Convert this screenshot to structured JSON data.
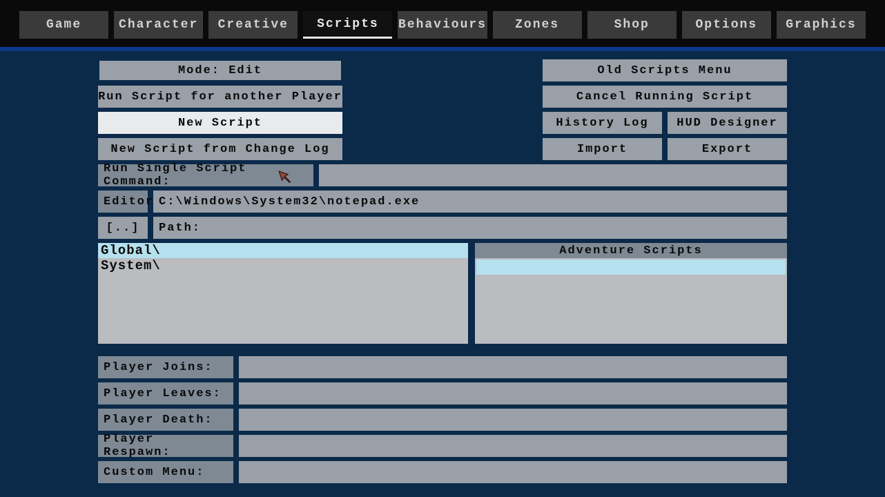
{
  "tabs": {
    "game": "Game",
    "character": "Character",
    "creative": "Creative",
    "scripts": "Scripts",
    "behaviours": "Behaviours",
    "zones": "Zones",
    "shop": "Shop",
    "options": "Options",
    "graphics": "Graphics"
  },
  "buttons": {
    "mode": "Mode: Edit",
    "run_for_player": "Run Script for another Player",
    "new_script": "New Script",
    "new_from_log": "New Script from Change Log",
    "old_menu": "Old Scripts Menu",
    "cancel_running": "Cancel Running Script",
    "history_log": "History Log",
    "hud_designer": "HUD Designer",
    "import": "Import",
    "export": "Export",
    "updir": "[..]"
  },
  "labels": {
    "run_single": "Run Single Script Command:",
    "editor": "Editor:",
    "path": "Path:",
    "adventure": "Adventure Scripts"
  },
  "values": {
    "run_single": "",
    "editor": "C:\\Windows\\System32\\notepad.exe",
    "path": ""
  },
  "folders": {
    "global": "Global\\",
    "system": "System\\"
  },
  "events": {
    "player_joins": {
      "label": "Player Joins:",
      "value": ""
    },
    "player_leaves": {
      "label": "Player Leaves:",
      "value": ""
    },
    "player_death": {
      "label": "Player Death:",
      "value": ""
    },
    "player_respawn": {
      "label": "Player Respawn:",
      "value": ""
    },
    "custom_menu": {
      "label": "Custom Menu:",
      "value": ""
    }
  }
}
